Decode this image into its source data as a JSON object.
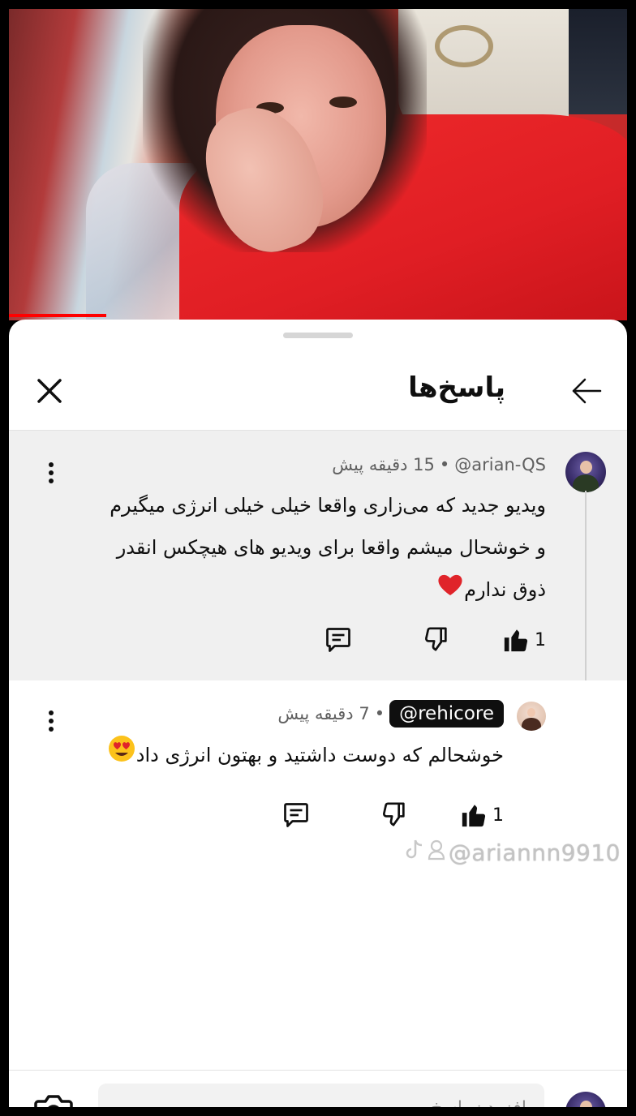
{
  "header": {
    "title": "پاسخ‌ها"
  },
  "parent_comment": {
    "handle": "@arian-QS",
    "separator": "•",
    "time": "15 دقیقه پیش",
    "lines": [
      "ویدیو جدید که می‌زاری واقعا خیلی خیلی انرژی میگیرم",
      "و خوشحال میشم واقعا برای ویدیو های هیچکس انقدر",
      "ذوق ندارم"
    ],
    "emoji": "❤️",
    "like_count": "1"
  },
  "reply_comment": {
    "handle": "@rehicore",
    "separator": "•",
    "time": "7 دقیقه پیش",
    "text": "خوشحالم که دوست داشتید و بهتون انرژی داد",
    "emoji": "😍",
    "like_count": "1"
  },
  "watermark": {
    "text": "@ariannn9910"
  },
  "footer": {
    "input_placeholder": "افزودن پاسخ..."
  },
  "colors": {
    "parent_bg": "#f0f0f0",
    "sheet_bg": "#ffffff",
    "text": "#0f0f0f",
    "meta": "#606060",
    "heart": "#e0242a"
  },
  "icons": {
    "close": "close-icon",
    "back": "arrow-left-icon",
    "more": "more-vertical-icon",
    "like": "thumbs-up-icon",
    "dislike": "thumbs-down-icon",
    "reply": "comment-icon",
    "camera": "camera-icon"
  }
}
